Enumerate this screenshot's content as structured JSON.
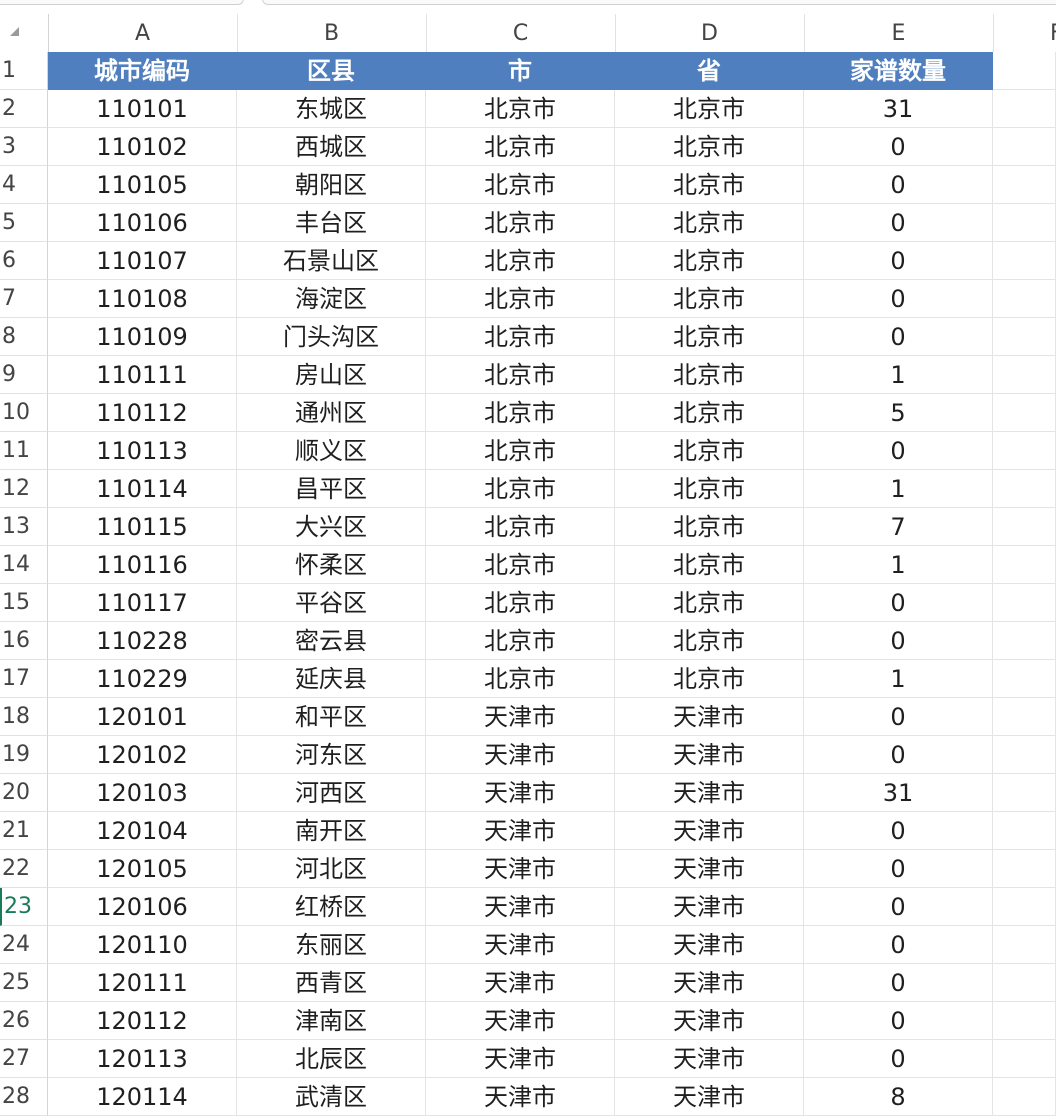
{
  "colors": {
    "header_fill": "#4f7fbf",
    "header_text": "#ffffff",
    "active_row_accent": "#1a7a5a"
  },
  "icons": {
    "corner": "select-all-triangle-icon"
  },
  "column_letters": [
    "A",
    "B",
    "C",
    "D",
    "E",
    "F"
  ],
  "active_row": "23",
  "header_row": {
    "number": "1",
    "cells": [
      "城市编码",
      "区县",
      "市",
      "省",
      "家谱数量"
    ]
  },
  "rows": [
    {
      "number": "2",
      "cells": [
        "110101",
        "东城区",
        "北京市",
        "北京市",
        "31"
      ]
    },
    {
      "number": "3",
      "cells": [
        "110102",
        "西城区",
        "北京市",
        "北京市",
        "0"
      ]
    },
    {
      "number": "4",
      "cells": [
        "110105",
        "朝阳区",
        "北京市",
        "北京市",
        "0"
      ]
    },
    {
      "number": "5",
      "cells": [
        "110106",
        "丰台区",
        "北京市",
        "北京市",
        "0"
      ]
    },
    {
      "number": "6",
      "cells": [
        "110107",
        "石景山区",
        "北京市",
        "北京市",
        "0"
      ]
    },
    {
      "number": "7",
      "cells": [
        "110108",
        "海淀区",
        "北京市",
        "北京市",
        "0"
      ]
    },
    {
      "number": "8",
      "cells": [
        "110109",
        "门头沟区",
        "北京市",
        "北京市",
        "0"
      ]
    },
    {
      "number": "9",
      "cells": [
        "110111",
        "房山区",
        "北京市",
        "北京市",
        "1"
      ]
    },
    {
      "number": "10",
      "cells": [
        "110112",
        "通州区",
        "北京市",
        "北京市",
        "5"
      ]
    },
    {
      "number": "11",
      "cells": [
        "110113",
        "顺义区",
        "北京市",
        "北京市",
        "0"
      ]
    },
    {
      "number": "12",
      "cells": [
        "110114",
        "昌平区",
        "北京市",
        "北京市",
        "1"
      ]
    },
    {
      "number": "13",
      "cells": [
        "110115",
        "大兴区",
        "北京市",
        "北京市",
        "7"
      ]
    },
    {
      "number": "14",
      "cells": [
        "110116",
        "怀柔区",
        "北京市",
        "北京市",
        "1"
      ]
    },
    {
      "number": "15",
      "cells": [
        "110117",
        "平谷区",
        "北京市",
        "北京市",
        "0"
      ]
    },
    {
      "number": "16",
      "cells": [
        "110228",
        "密云县",
        "北京市",
        "北京市",
        "0"
      ]
    },
    {
      "number": "17",
      "cells": [
        "110229",
        "延庆县",
        "北京市",
        "北京市",
        "1"
      ]
    },
    {
      "number": "18",
      "cells": [
        "120101",
        "和平区",
        "天津市",
        "天津市",
        "0"
      ]
    },
    {
      "number": "19",
      "cells": [
        "120102",
        "河东区",
        "天津市",
        "天津市",
        "0"
      ]
    },
    {
      "number": "20",
      "cells": [
        "120103",
        "河西区",
        "天津市",
        "天津市",
        "31"
      ]
    },
    {
      "number": "21",
      "cells": [
        "120104",
        "南开区",
        "天津市",
        "天津市",
        "0"
      ]
    },
    {
      "number": "22",
      "cells": [
        "120105",
        "河北区",
        "天津市",
        "天津市",
        "0"
      ]
    },
    {
      "number": "23",
      "cells": [
        "120106",
        "红桥区",
        "天津市",
        "天津市",
        "0"
      ]
    },
    {
      "number": "24",
      "cells": [
        "120110",
        "东丽区",
        "天津市",
        "天津市",
        "0"
      ]
    },
    {
      "number": "25",
      "cells": [
        "120111",
        "西青区",
        "天津市",
        "天津市",
        "0"
      ]
    },
    {
      "number": "26",
      "cells": [
        "120112",
        "津南区",
        "天津市",
        "天津市",
        "0"
      ]
    },
    {
      "number": "27",
      "cells": [
        "120113",
        "北辰区",
        "天津市",
        "天津市",
        "0"
      ]
    },
    {
      "number": "28",
      "cells": [
        "120114",
        "武清区",
        "天津市",
        "天津市",
        "8"
      ]
    }
  ]
}
